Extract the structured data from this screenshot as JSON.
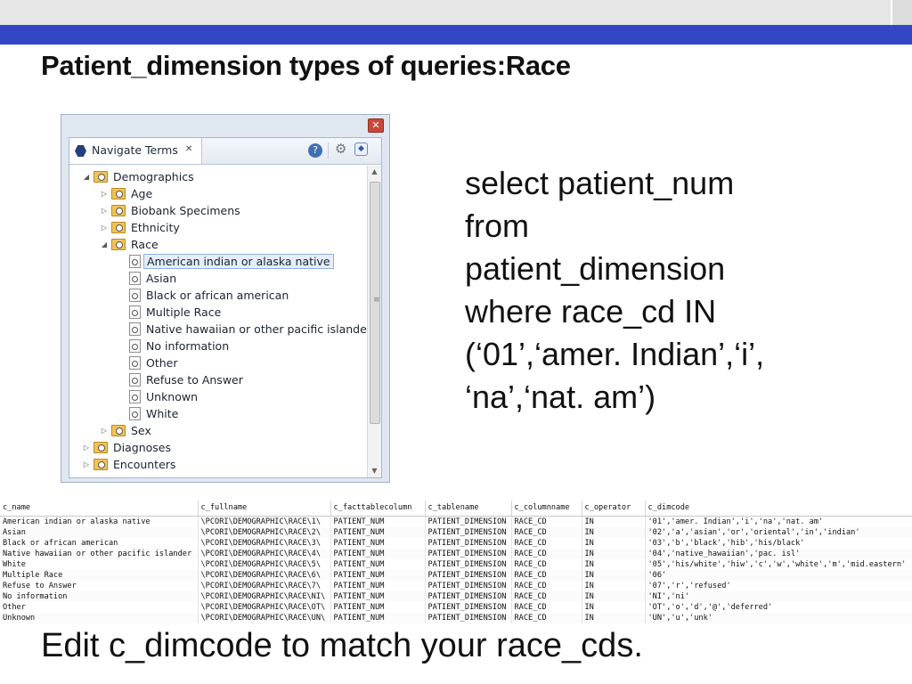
{
  "slide": {
    "title": "Patient_dimension types of queries:Race",
    "bottom_note": "Edit c_dimcode to match your race_cds."
  },
  "nav_window": {
    "close_glyph": "✕",
    "tab_label": "Navigate Terms",
    "tab_close_glyph": "✕",
    "toolbar": {
      "help_glyph": "?",
      "settings_glyph": "⚙",
      "menu_glyph": "◆"
    },
    "tree": [
      {
        "label": "Demographics",
        "twisty": "◢",
        "type": "folder"
      },
      {
        "label": "Age",
        "twisty": "▷",
        "type": "folder"
      },
      {
        "label": "Biobank Specimens",
        "twisty": "▷",
        "type": "folder"
      },
      {
        "label": "Ethnicity",
        "twisty": "▷",
        "type": "folder"
      },
      {
        "label": "Race",
        "twisty": "◢",
        "type": "folder"
      },
      {
        "label": "American indian or alaska native",
        "type": "leaf",
        "selected": true
      },
      {
        "label": "Asian",
        "type": "leaf"
      },
      {
        "label": "Black or african american",
        "type": "leaf"
      },
      {
        "label": "Multiple Race",
        "type": "leaf"
      },
      {
        "label": "Native hawaiian or other pacific islander",
        "type": "leaf"
      },
      {
        "label": "No information",
        "type": "leaf"
      },
      {
        "label": "Other",
        "type": "leaf"
      },
      {
        "label": "Refuse to Answer",
        "type": "leaf"
      },
      {
        "label": "Unknown",
        "type": "leaf"
      },
      {
        "label": "White",
        "type": "leaf"
      },
      {
        "label": "Sex",
        "twisty": "▷",
        "type": "folder"
      },
      {
        "label": "Diagnoses",
        "twisty": "▷",
        "type": "folder"
      },
      {
        "label": "Encounters",
        "twisty": "▷",
        "type": "folder"
      }
    ],
    "scrollbar": {
      "up_glyph": "▲",
      "down_glyph": "▼",
      "grip_glyph": "≡"
    }
  },
  "sql": {
    "lines": [
      "select patient_num",
      "from",
      "patient_dimension",
      "where race_cd IN",
      "(‘01’,‘amer. Indian’,‘i’,",
      "‘na’,‘nat. am’)"
    ]
  },
  "table": {
    "headers": [
      "c_name",
      "c_fullname",
      "c_facttablecolumn",
      "c_tablename",
      "c_columnname",
      "c_operator",
      "c_dimcode"
    ],
    "rows": [
      [
        "American indian or alaska native",
        "\\PCORI\\DEMOGRAPHIC\\RACE\\1\\",
        "PATIENT_NUM",
        "PATIENT_DIMENSION",
        "RACE_CD",
        "IN",
        "'01','amer. Indian','i','na','nat. am'"
      ],
      [
        "Asian",
        "\\PCORI\\DEMOGRAPHIC\\RACE\\2\\",
        "PATIENT_NUM",
        "PATIENT_DIMENSION",
        "RACE_CD",
        "IN",
        "'02','a','asian','or','oriental','in','indian'"
      ],
      [
        "Black or african american",
        "\\PCORI\\DEMOGRAPHIC\\RACE\\3\\",
        "PATIENT_NUM",
        "PATIENT_DIMENSION",
        "RACE_CD",
        "IN",
        "'03','b','black','hib','his/black'"
      ],
      [
        "Native hawaiian or other pacific islander",
        "\\PCORI\\DEMOGRAPHIC\\RACE\\4\\",
        "PATIENT_NUM",
        "PATIENT_DIMENSION",
        "RACE_CD",
        "IN",
        "'04','native_hawaiian','pac. isl'"
      ],
      [
        "White",
        "\\PCORI\\DEMOGRAPHIC\\RACE\\5\\",
        "PATIENT_NUM",
        "PATIENT_DIMENSION",
        "RACE_CD",
        "IN",
        "'05','his/white','hiw','c','w','white','m','mid.eastern'"
      ],
      [
        "Multiple Race",
        "\\PCORI\\DEMOGRAPHIC\\RACE\\6\\",
        "PATIENT_NUM",
        "PATIENT_DIMENSION",
        "RACE_CD",
        "IN",
        "'06'"
      ],
      [
        "Refuse to Answer",
        "\\PCORI\\DEMOGRAPHIC\\RACE\\7\\",
        "PATIENT_NUM",
        "PATIENT_DIMENSION",
        "RACE_CD",
        "IN",
        "'07','r','refused'"
      ],
      [
        "No information",
        "\\PCORI\\DEMOGRAPHIC\\RACE\\NI\\",
        "PATIENT_NUM",
        "PATIENT_DIMENSION",
        "RACE_CD",
        "IN",
        "'NI','ni'"
      ],
      [
        "Other",
        "\\PCORI\\DEMOGRAPHIC\\RACE\\OT\\",
        "PATIENT_NUM",
        "PATIENT_DIMENSION",
        "RACE_CD",
        "IN",
        "'OT','o','d','@','deferred'"
      ],
      [
        "Unknown",
        "\\PCORI\\DEMOGRAPHIC\\RACE\\UN\\",
        "PATIENT_NUM",
        "PATIENT_DIMENSION",
        "RACE_CD",
        "IN",
        "'UN','u','unk'"
      ]
    ]
  },
  "colors": {
    "header_bar": "#3346c6",
    "selection_fill": "#e4eefb",
    "folder": "#f0c35a"
  }
}
